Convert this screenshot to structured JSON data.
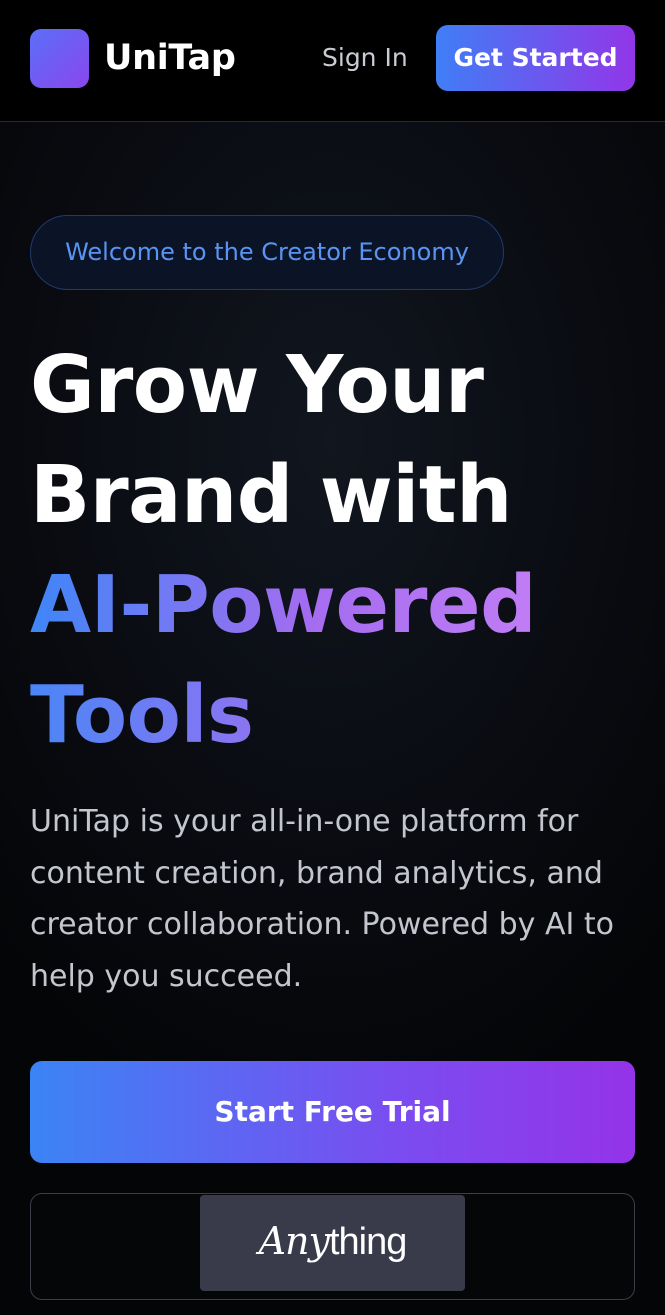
{
  "header": {
    "brand_name": "UniTap",
    "logo_icon": "unitap-logo-square",
    "signin_label": "Sign In",
    "get_started_label": "Get Started"
  },
  "hero": {
    "badge": "Welcome to the Creator Economy",
    "headline_line1": "Grow Your",
    "headline_line2": "Brand with",
    "headline_line3": "AI-Powered",
    "headline_line4": "Tools",
    "description": "UniTap is your all-in-one platform for content creation, brand analytics, and creator collaboration. Powered by AI to help you succeed.",
    "primary_cta": "Start Free Trial"
  },
  "watermark": {
    "part1": "Any",
    "part2": "thing"
  },
  "colors": {
    "accent_start": "#3f7ef6",
    "accent_end": "#9236e8",
    "badge_text": "#5a94f3",
    "background": "#000000"
  }
}
